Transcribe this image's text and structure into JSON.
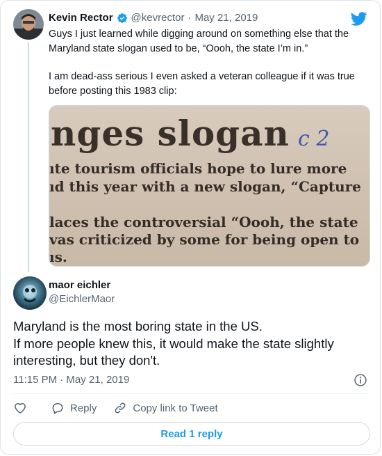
{
  "quoted_tweet": {
    "author_name": "Kevin Rector",
    "handle": "@kevrector",
    "separator": "·",
    "date": "May 21, 2019",
    "text_p1": "Guys I just learned while digging around on something else that the Maryland state slogan used to be, “Oooh, the state I’m in.”",
    "text_p2": "I am dead-ass serious I even asked a veteran colleague if it was true before posting this 1983 clip:",
    "clip": {
      "headline": "nges slogan",
      "handwritten_mark": "c 2",
      "lines": [
        "ıte tourism officials hope to lure more",
        "ıd this year with a new slogan, “Capture",
        "laces the controversial “Oooh, the state",
        "vas criticized by some for being open to",
        "ıs."
      ]
    }
  },
  "reply": {
    "author_name": "maor eichler",
    "handle": "@EichlerMaor",
    "text_line1": "Maryland is the most boring state in the US.",
    "text_line2": "If more people knew this, it would make the state slightly",
    "text_line3": "interesting, but they don't.",
    "timestamp": "11:15 PM · May 21, 2019"
  },
  "actions": {
    "reply_label": "Reply",
    "copy_link_label": "Copy link to Tweet",
    "read_replies_label": "Read 1 reply"
  },
  "colors": {
    "accent": "#1d9bf0",
    "text_primary": "#0f1419",
    "text_secondary": "#536471",
    "border": "#cfd9de"
  },
  "icons": [
    "verified-badge-icon",
    "twitter-bird-icon",
    "info-icon",
    "heart-icon",
    "reply-bubble-icon",
    "link-icon"
  ]
}
